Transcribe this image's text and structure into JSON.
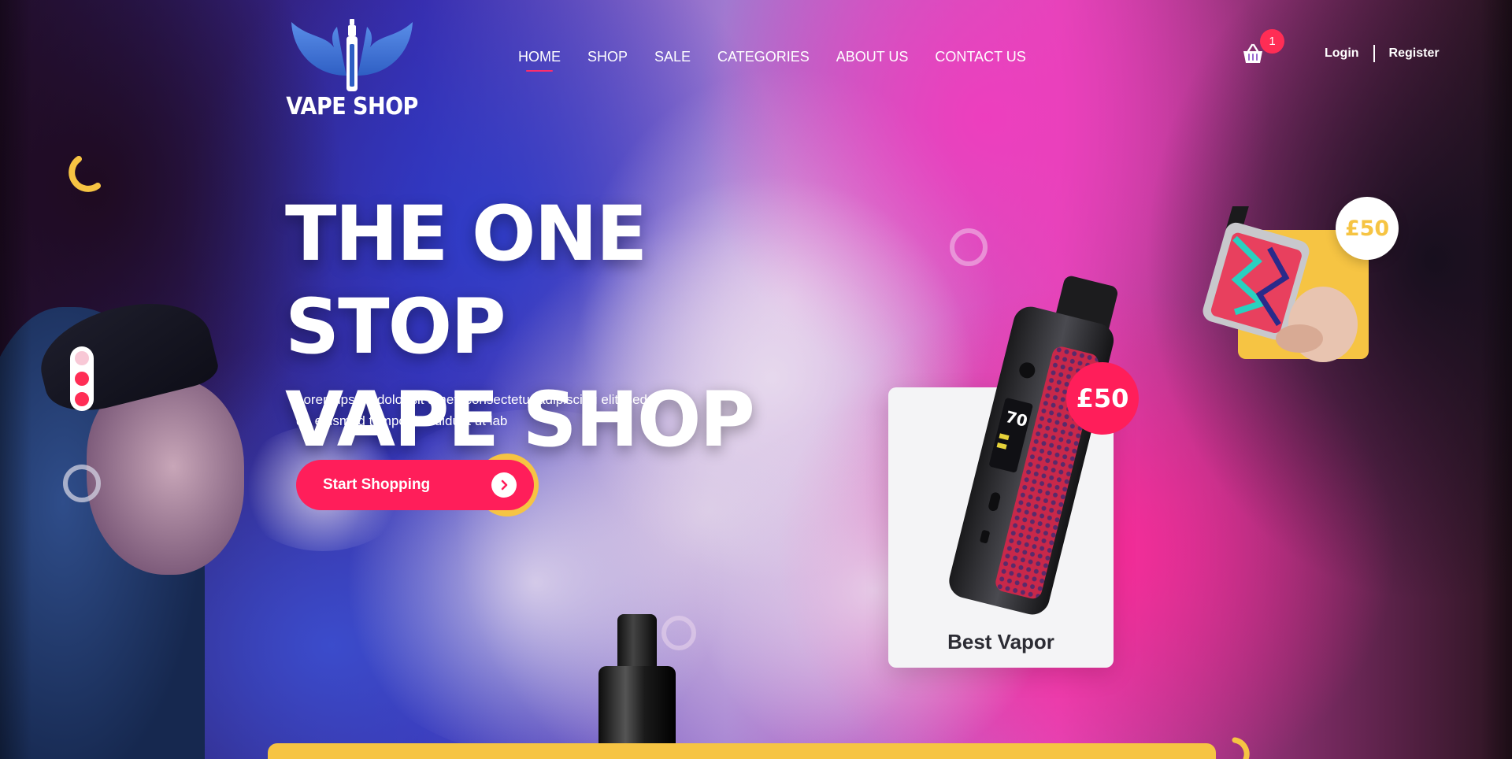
{
  "brand": {
    "logo_text": "VAPE SHOP"
  },
  "nav": {
    "items": [
      {
        "label": "HOME",
        "active": true
      },
      {
        "label": "SHOP",
        "active": false
      },
      {
        "label": "SALE",
        "active": false
      },
      {
        "label": "CATEGORIES",
        "active": false
      },
      {
        "label": "ABOUT US",
        "active": false
      },
      {
        "label": "CONTACT US",
        "active": false
      }
    ]
  },
  "cart": {
    "count": "1",
    "icon": "basket-icon"
  },
  "auth": {
    "login_label": "Login",
    "register_label": "Register"
  },
  "hero": {
    "title_line1": "THE ONE STOP",
    "title_line2": "VAPE SHOP",
    "subtitle": "Lorem ipsum dolor sit amet, consectetur adipiscing elit, sed do eiusmod tempor incididunt ut lab",
    "cta_label": "Start Shopping",
    "cta_icon": "chevron-right-icon"
  },
  "slider": {
    "dot_count": 3
  },
  "featured": {
    "product_name": "Best Vapor",
    "price": "£50"
  },
  "secondary": {
    "price": "£50"
  },
  "colors": {
    "accent_pink": "#ff1e5a",
    "accent_yellow": "#f6c443",
    "badge_red": "#ff2d55",
    "card_bg": "#f4f4f6"
  }
}
